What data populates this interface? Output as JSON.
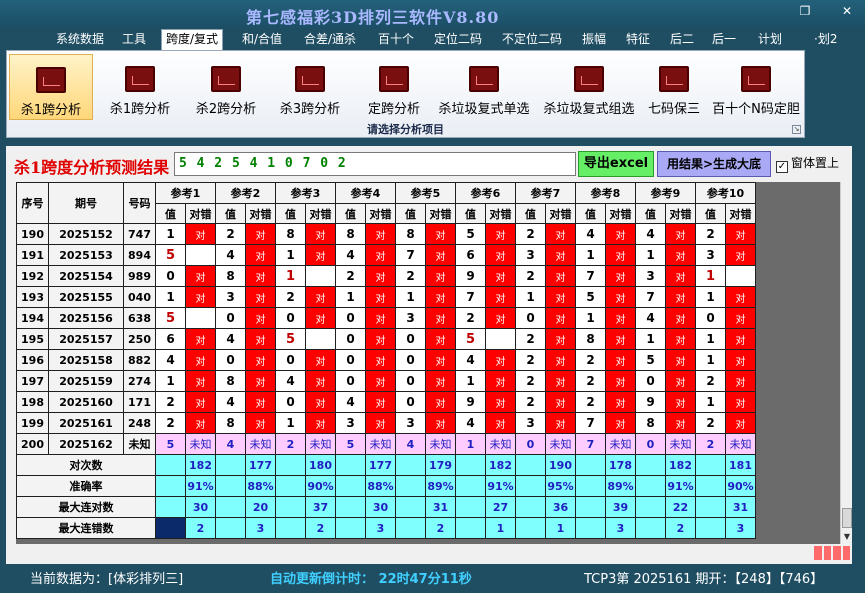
{
  "app": {
    "title": "第七感福彩3D排列三软件V8.80",
    "restore_icon": "restore-icon",
    "close_icon": "close-icon"
  },
  "menu": [
    {
      "label": "系统数据",
      "active": false
    },
    {
      "label": "工具",
      "active": false
    },
    {
      "label": "跨度/复式",
      "active": true
    },
    {
      "label": "和/合值",
      "active": false
    },
    {
      "label": "合差/通杀",
      "active": false
    },
    {
      "label": "百十个",
      "active": false
    },
    {
      "label": "定位二码",
      "active": false
    },
    {
      "label": "不定位二码",
      "active": false
    },
    {
      "label": "振幅",
      "active": false
    },
    {
      "label": "特征",
      "active": false
    },
    {
      "label": "后二",
      "active": false
    },
    {
      "label": "后一",
      "active": false
    },
    {
      "label": "计划",
      "active": false
    },
    {
      "label": "·划2",
      "active": false
    }
  ],
  "ribbon": {
    "buttons": [
      {
        "label": "杀1跨分析",
        "selected": true
      },
      {
        "label": "杀1跨分析",
        "selected": false
      },
      {
        "label": "杀2跨分析",
        "selected": false
      },
      {
        "label": "杀3跨分析",
        "selected": false
      },
      {
        "label": "定跨分析",
        "selected": false
      },
      {
        "label": "杀垃圾复式单选",
        "selected": false
      },
      {
        "label": "杀垃圾复式组选",
        "selected": false
      },
      {
        "label": "七码保三",
        "selected": false
      },
      {
        "label": "百十个N码定胆",
        "selected": false
      }
    ],
    "caption": "请选择分析项目"
  },
  "panel": {
    "result_label": "杀1跨度分析预测结果",
    "result_value": "5 4 2 5 4 1 0 7 0 2",
    "export_label": "导出excel",
    "generate_label": "用结果>生成大底",
    "topmost_label": "窗体置上",
    "topmost_checked": "✓"
  },
  "grid": {
    "col_seq": "序号",
    "col_period": "期号",
    "col_number": "号码",
    "refs": [
      "参考1",
      "参考2",
      "参考3",
      "参考4",
      "参考5",
      "参考6",
      "参考7",
      "参考8",
      "参考9",
      "参考10"
    ],
    "sub_value": "值",
    "sub_result": "对错",
    "hit_text": "对",
    "rows": [
      {
        "seq": "190",
        "period": "2025152",
        "number": "747",
        "values": [
          "1",
          "2",
          "8",
          "8",
          "8",
          "5",
          "2",
          "4",
          "4",
          "2"
        ],
        "hits": [
          1,
          1,
          1,
          1,
          1,
          1,
          1,
          1,
          1,
          1
        ]
      },
      {
        "seq": "191",
        "period": "2025153",
        "number": "894",
        "values": [
          "5",
          "4",
          "1",
          "4",
          "7",
          "6",
          "3",
          "1",
          "1",
          "3"
        ],
        "hits": [
          0,
          1,
          1,
          1,
          1,
          1,
          1,
          1,
          1,
          1
        ]
      },
      {
        "seq": "192",
        "period": "2025154",
        "number": "989",
        "values": [
          "0",
          "8",
          "1",
          "2",
          "2",
          "9",
          "2",
          "7",
          "3",
          "1"
        ],
        "hits": [
          1,
          1,
          0,
          1,
          1,
          1,
          1,
          1,
          1,
          0
        ]
      },
      {
        "seq": "193",
        "period": "2025155",
        "number": "040",
        "values": [
          "1",
          "3",
          "2",
          "1",
          "1",
          "7",
          "1",
          "5",
          "7",
          "1"
        ],
        "hits": [
          1,
          1,
          1,
          1,
          1,
          1,
          1,
          1,
          1,
          1
        ]
      },
      {
        "seq": "194",
        "period": "2025156",
        "number": "638",
        "values": [
          "5",
          "0",
          "0",
          "0",
          "3",
          "2",
          "0",
          "1",
          "4",
          "0"
        ],
        "hits": [
          0,
          1,
          1,
          1,
          1,
          1,
          1,
          1,
          1,
          1
        ]
      },
      {
        "seq": "195",
        "period": "2025157",
        "number": "250",
        "values": [
          "6",
          "4",
          "5",
          "0",
          "0",
          "5",
          "2",
          "8",
          "1",
          "1"
        ],
        "hits": [
          1,
          1,
          0,
          1,
          1,
          0,
          1,
          1,
          1,
          1
        ]
      },
      {
        "seq": "196",
        "period": "2025158",
        "number": "882",
        "values": [
          "4",
          "0",
          "0",
          "0",
          "0",
          "4",
          "2",
          "2",
          "5",
          "1"
        ],
        "hits": [
          1,
          1,
          1,
          1,
          1,
          1,
          1,
          1,
          1,
          1
        ]
      },
      {
        "seq": "197",
        "period": "2025159",
        "number": "274",
        "values": [
          "1",
          "8",
          "4",
          "0",
          "0",
          "1",
          "2",
          "2",
          "0",
          "2"
        ],
        "hits": [
          1,
          1,
          1,
          1,
          1,
          1,
          1,
          1,
          1,
          1
        ]
      },
      {
        "seq": "198",
        "period": "2025160",
        "number": "171",
        "values": [
          "2",
          "4",
          "0",
          "4",
          "0",
          "9",
          "2",
          "2",
          "9",
          "1"
        ],
        "hits": [
          1,
          1,
          1,
          1,
          1,
          1,
          1,
          1,
          1,
          1
        ]
      },
      {
        "seq": "199",
        "period": "2025161",
        "number": "248",
        "values": [
          "2",
          "8",
          "1",
          "3",
          "3",
          "4",
          "3",
          "7",
          "8",
          "2"
        ],
        "hits": [
          1,
          1,
          1,
          1,
          1,
          1,
          1,
          1,
          1,
          1
        ]
      }
    ],
    "last_row": {
      "seq": "200",
      "period": "2025162",
      "number": "未知",
      "values": [
        "5",
        "4",
        "2",
        "5",
        "4",
        "1",
        "0",
        "7",
        "0",
        "2"
      ],
      "unknown": "未知"
    },
    "stats": [
      {
        "label": "对次数",
        "values": [
          "182",
          "177",
          "180",
          "177",
          "179",
          "182",
          "190",
          "178",
          "182",
          "181"
        ]
      },
      {
        "label": "准确率",
        "values": [
          "91%",
          "88%",
          "90%",
          "88%",
          "89%",
          "91%",
          "95%",
          "89%",
          "91%",
          "90%"
        ]
      },
      {
        "label": "最大连对数",
        "values": [
          "30",
          "20",
          "37",
          "30",
          "31",
          "27",
          "36",
          "39",
          "22",
          "31"
        ]
      },
      {
        "label": "最大连错数",
        "values": [
          "2",
          "3",
          "2",
          "3",
          "2",
          "1",
          "1",
          "3",
          "2",
          "3"
        ]
      }
    ]
  },
  "status": {
    "source": "当前数据为：[体彩排列三]",
    "countdown": "自动更新倒计时：  22时47分11秒",
    "draw": "TCP3第 2025161 期开：【248】【746】"
  }
}
